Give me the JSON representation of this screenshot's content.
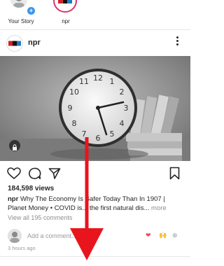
{
  "stories": [
    {
      "label": "Your Story"
    },
    {
      "label": "npr",
      "badge": "npr"
    }
  ],
  "post": {
    "username": "npr",
    "avatar_badge": "npr",
    "views": "184,598 views",
    "caption_user": "npr",
    "caption_text": "Why The Economy Is Safer Today Than In 1907 | Planet Money • COVID is... the first natural dis...",
    "more_label": "more",
    "view_all": "View all 195 comments",
    "add_comment_placeholder": "Add a comment...",
    "emoji_1": "❤",
    "emoji_2": "🙌",
    "emoji_3": "⊕",
    "time": "3 hours ago"
  },
  "colors": {
    "accent": "#e1306c",
    "blue": "#3897f0",
    "arrow": "#e8151c",
    "heart": "#ed4956"
  }
}
